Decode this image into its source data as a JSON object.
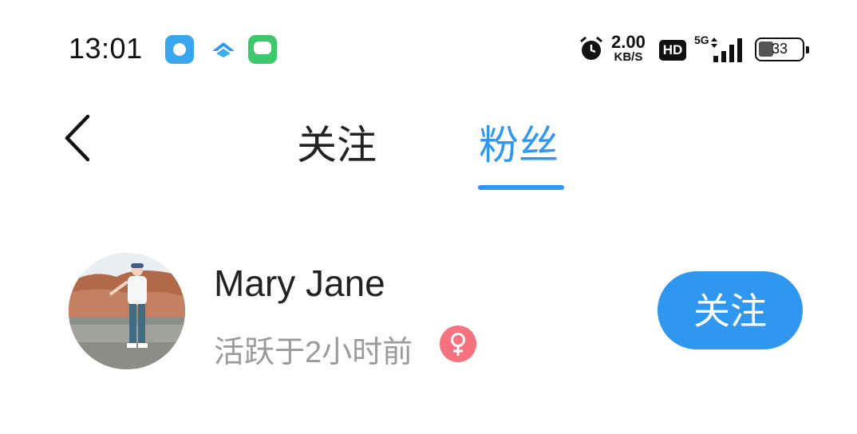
{
  "status_bar": {
    "time": "13:01",
    "net_speed_value": "2.00",
    "net_speed_unit": "KB/S",
    "hd_label": "HD",
    "network_label": "5G",
    "battery_level": "33",
    "icons": [
      "app-icon-blue",
      "app-icon-bird",
      "messages-icon",
      "alarm-icon",
      "signal-icon",
      "battery-icon"
    ]
  },
  "header": {
    "tabs": [
      {
        "label": "关注",
        "active": false
      },
      {
        "label": "粉丝",
        "active": true
      }
    ],
    "accent_color": "#2f97ef"
  },
  "list": [
    {
      "name": "Mary Jane",
      "status": "活跃于2小时前",
      "gender": "female",
      "action_label": "关注"
    }
  ]
}
